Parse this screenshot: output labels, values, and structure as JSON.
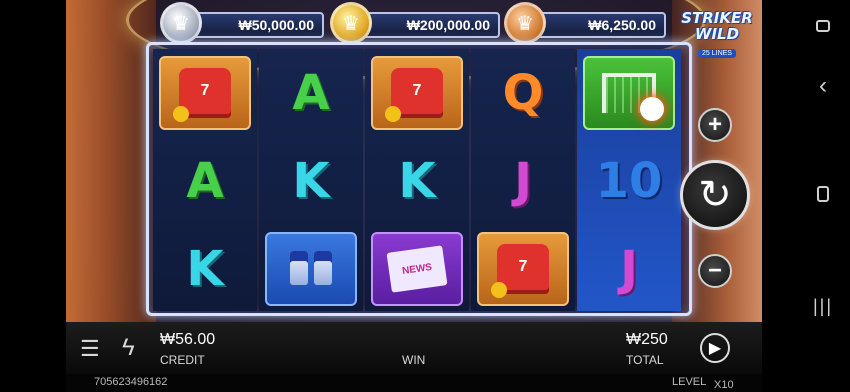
{
  "jackpots": [
    {
      "tier": "silver",
      "icon": "silver-crown-medal",
      "amount": "₩50,000.00"
    },
    {
      "tier": "gold",
      "icon": "gold-crown-medal",
      "amount": "₩200,000.00"
    },
    {
      "tier": "bronze",
      "icon": "bronze-crown-medal",
      "amount": "₩6,250.00"
    }
  ],
  "logo": {
    "line1": "STRIKER",
    "line2": "WILD",
    "badge": "25 LINES"
  },
  "reels": [
    [
      "jersey",
      "A",
      "K"
    ],
    [
      "A",
      "K",
      "drinks"
    ],
    [
      "jersey",
      "K",
      "news"
    ],
    [
      "Q",
      "J",
      "jersey"
    ],
    [
      "wild",
      "10",
      "J"
    ]
  ],
  "symbols": {
    "jersey_number": "7",
    "news_text": "NEWS"
  },
  "controls": {
    "increase_icon": "+",
    "spin_icon": "↻",
    "decrease_icon": "−",
    "menu_icon": "☰",
    "turbo_icon": "ϟ",
    "autoplay_icon": "▶"
  },
  "bottom": {
    "credit_value": "₩56.00",
    "credit_label": "CREDIT",
    "win_label": "WIN",
    "total_value": "₩250",
    "total_label": "TOTAL"
  },
  "status": {
    "session_id": "705623496162",
    "level_label": "LEVEL",
    "level_value": "X10"
  },
  "android_nav": {
    "recents_icon": "recents-icon",
    "back_icon": "back-chevron-icon",
    "home_icon": "home-icon",
    "menu_icon": "menu-bars-icon"
  },
  "colors": {
    "letter_A": "#49d04a",
    "letter_K": "#38d6e6",
    "letter_Q": "#ff8a2a",
    "letter_J": "#d24ad2",
    "number_10": "#2f7ee8"
  }
}
